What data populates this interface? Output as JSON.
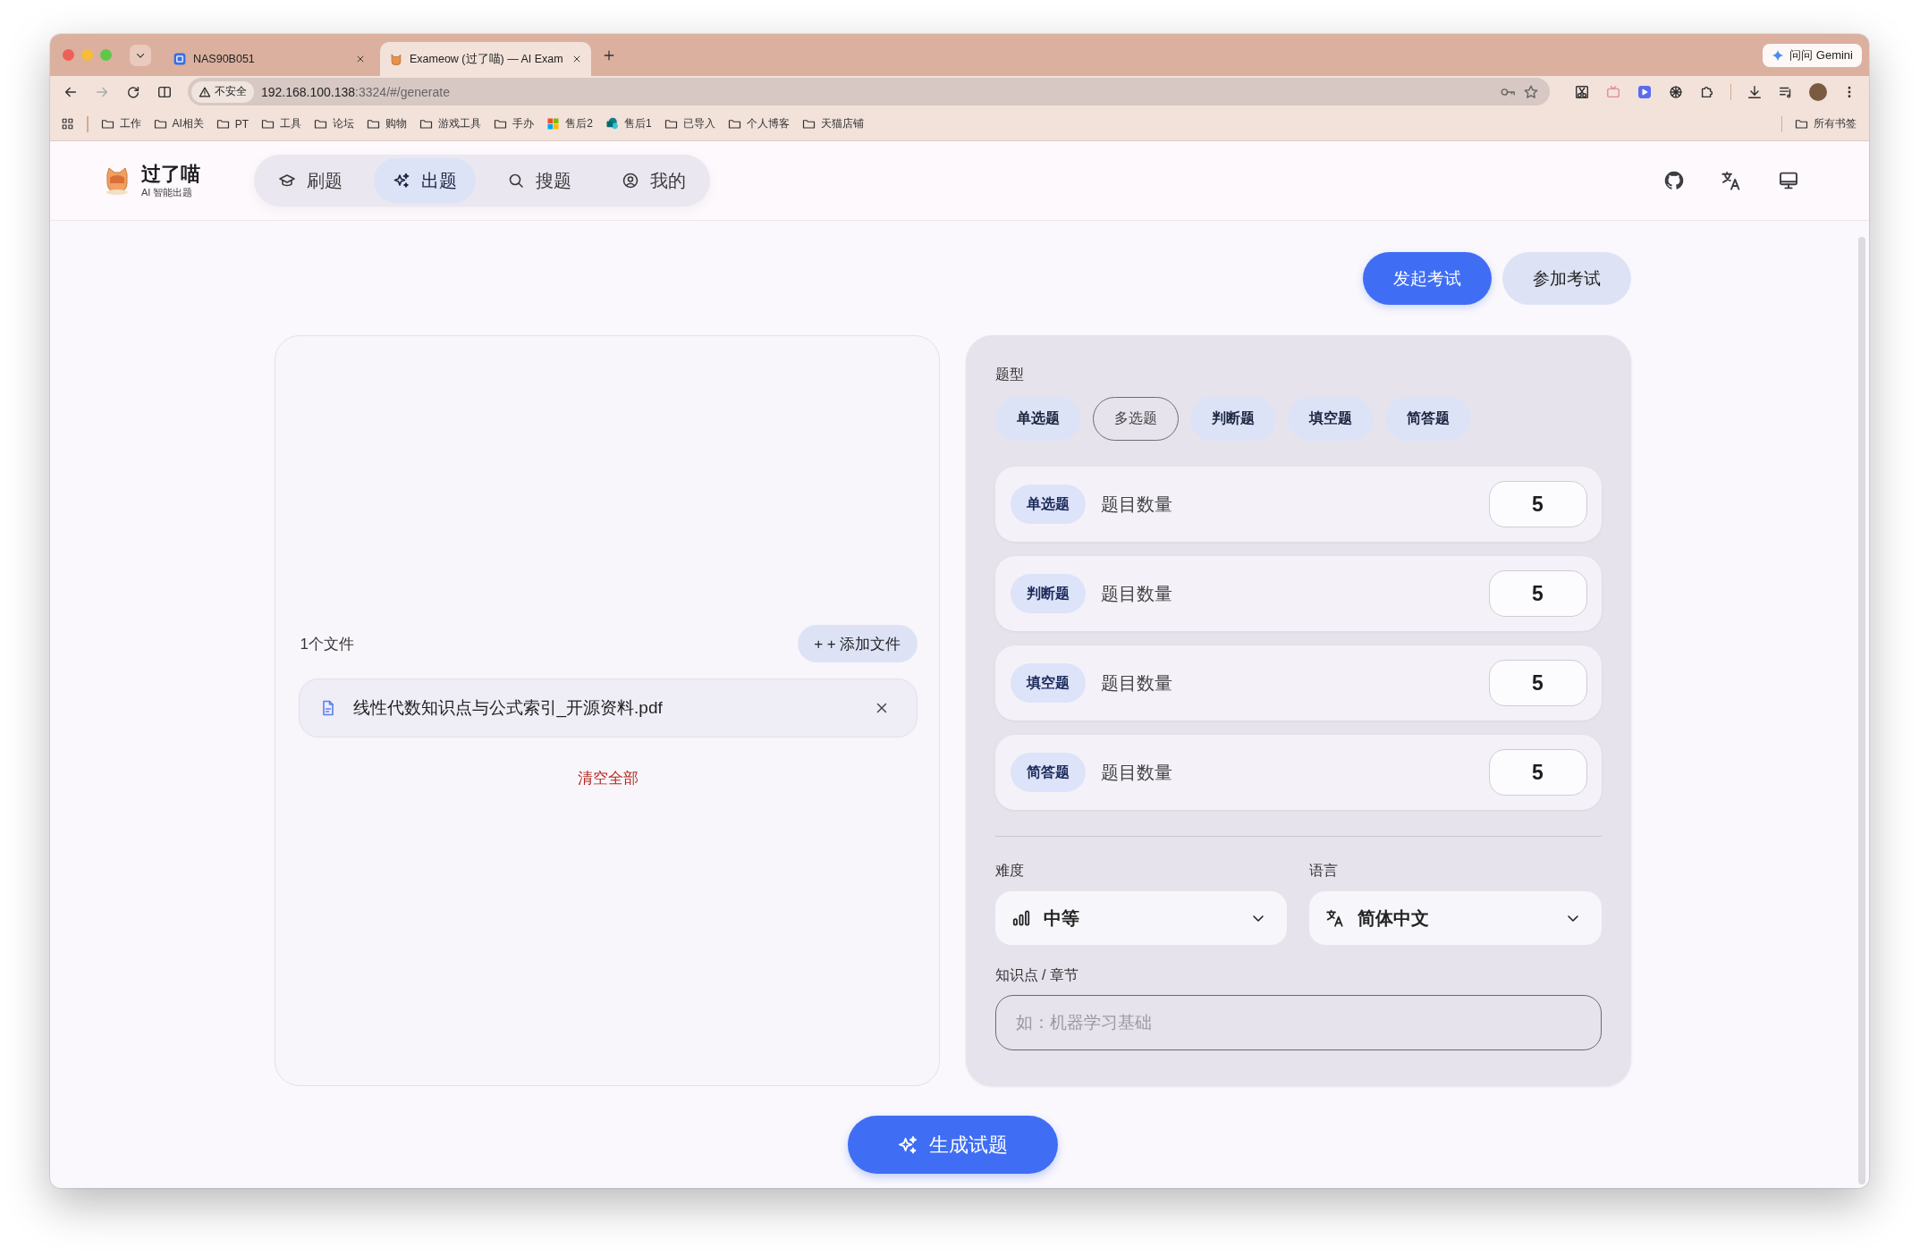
{
  "browser": {
    "tabs": [
      {
        "title": "NAS90B051",
        "selected": false
      },
      {
        "title": "Exameow (过了喵) — AI Exam",
        "selected": true
      }
    ],
    "address": {
      "security_label": "不安全",
      "host": "192.168.100.138",
      "path": ":3324/#/generate"
    },
    "gemini_button": "问问 Gemini",
    "bookmarks": [
      {
        "label": "工作",
        "kind": "folder"
      },
      {
        "label": "AI相关",
        "kind": "folder"
      },
      {
        "label": "PT",
        "kind": "folder"
      },
      {
        "label": "工具",
        "kind": "folder"
      },
      {
        "label": "论坛",
        "kind": "folder"
      },
      {
        "label": "购物",
        "kind": "folder"
      },
      {
        "label": "游戏工具",
        "kind": "folder"
      },
      {
        "label": "手办",
        "kind": "folder"
      },
      {
        "label": "售后2",
        "kind": "site"
      },
      {
        "label": "售后1",
        "kind": "site"
      },
      {
        "label": "已导入",
        "kind": "folder"
      },
      {
        "label": "个人博客",
        "kind": "folder"
      },
      {
        "label": "天猫店铺",
        "kind": "folder"
      }
    ],
    "all_bookmarks": "所有书签"
  },
  "app": {
    "brand": {
      "name": "过了喵",
      "subtitle": "AI 智能出题"
    },
    "nav": [
      {
        "label": "刷题",
        "selected": false
      },
      {
        "label": "出题",
        "selected": true
      },
      {
        "label": "搜题",
        "selected": false
      },
      {
        "label": "我的",
        "selected": false
      }
    ],
    "actions": [
      {
        "label": "发起考试",
        "kind": "primary"
      },
      {
        "label": "参加考试",
        "kind": "secondary"
      }
    ],
    "upload": {
      "file_count": "1个文件",
      "add_button": "+ + 添加文件",
      "files": [
        {
          "name": "线性代数知识点与公式索引_开源资料.pdf"
        }
      ],
      "clear_all": "清空全部"
    },
    "config": {
      "type_label": "题型",
      "types": [
        {
          "label": "单选题",
          "selected": true
        },
        {
          "label": "多选题",
          "selected": false
        },
        {
          "label": "判断题",
          "selected": true
        },
        {
          "label": "填空题",
          "selected": true
        },
        {
          "label": "简答题",
          "selected": true
        }
      ],
      "counts": [
        {
          "type": "单选题",
          "label": "题目数量",
          "value": "5"
        },
        {
          "type": "判断题",
          "label": "题目数量",
          "value": "5"
        },
        {
          "type": "填空题",
          "label": "题目数量",
          "value": "5"
        },
        {
          "type": "简答题",
          "label": "题目数量",
          "value": "5"
        }
      ],
      "difficulty": {
        "label": "难度",
        "value": "中等"
      },
      "language": {
        "label": "语言",
        "value": "简体中文"
      },
      "topic": {
        "label": "知识点 / 章节",
        "placeholder": "如：机器学习基础"
      }
    },
    "generate_button": "生成试题"
  }
}
